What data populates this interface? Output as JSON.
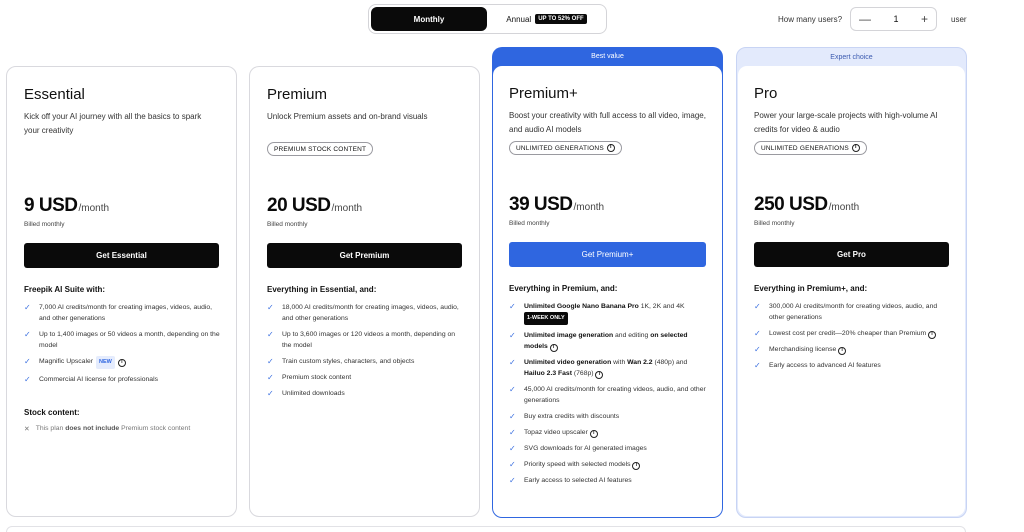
{
  "billing": {
    "monthly_label": "Monthly",
    "annual_label": "Annual",
    "annual_badge": "UP TO 52% OFF"
  },
  "users": {
    "label": "How many users?",
    "minus": "—",
    "value": "1",
    "plus": "+",
    "suffix": "user"
  },
  "plans": {
    "essential": {
      "name": "Essential",
      "desc": "Kick off your AI journey with all the basics to spark your creativity",
      "price": "9 USD",
      "per": "/month",
      "billed": "Billed monthly",
      "cta": "Get Essential",
      "features_head": "Freepik AI Suite with:",
      "f1": "7,000 AI credits/month for creating images, videos, audio, and other generations",
      "f2": "Up to 1,400 images or 50 videos a month, depending on the model",
      "f3": "Magnific Upscaler",
      "f3_tag": "NEW",
      "f4": "Commercial AI license for professionals",
      "stock_head": "Stock content:",
      "stock_a": "This plan",
      "stock_b": "does not include",
      "stock_c": "Premium stock content"
    },
    "premium": {
      "name": "Premium",
      "desc": "Unlock Premium assets and on-brand visuals",
      "pill": "PREMIUM STOCK CONTENT",
      "price": "20 USD",
      "per": "/month",
      "billed": "Billed monthly",
      "cta": "Get Premium",
      "features_head": "Everything in Essential, and:",
      "f1": "18,000 AI credits/month for creating images, videos, audio, and other generations",
      "f2": "Up to 3,600 images or 120 videos a month, depending on the model",
      "f3": "Train custom styles, characters, and objects",
      "f4": "Premium stock content",
      "f5": "Unlimited downloads"
    },
    "premium_plus": {
      "ribbon": "Best value",
      "name": "Premium+",
      "desc": "Boost your creativity with full access to all video, image, and audio AI models",
      "pill": "UNLIMITED GENERATIONS",
      "price": "39 USD",
      "per": "/month",
      "billed": "Billed monthly",
      "cta": "Get Premium+",
      "features_head": "Everything in Premium, and:",
      "f1_b": "Unlimited Google Nano Banana Pro",
      "f1_r": "1K, 2K and 4K",
      "f1_tag": "1-WEEK ONLY",
      "f2_b1": "Unlimited image generation",
      "f2_r": "and editing",
      "f2_b2": "on selected models",
      "f3_b1": "Unlimited video generation",
      "f3_r1": "with",
      "f3_b2": "Wan 2.2",
      "f3_r2": "(480p) and",
      "f3_b3": "Hailuo 2.3 Fast",
      "f3_r3": "(768p)",
      "f4": "45,000 AI credits/month for creating videos, audio, and other generations",
      "f5": "Buy extra credits with discounts",
      "f6": "Topaz video upscaler",
      "f7": "SVG downloads for AI generated images",
      "f8": "Priority speed with selected models",
      "f9": "Early access to selected AI features"
    },
    "pro": {
      "ribbon": "Expert choice",
      "name": "Pro",
      "desc": "Power your large-scale projects with high-volume AI credits for video & audio",
      "pill": "UNLIMITED GENERATIONS",
      "price": "250 USD",
      "per": "/month",
      "billed": "Billed monthly",
      "cta": "Get Pro",
      "features_head": "Everything in Premium+, and:",
      "f1": "300,000 AI credits/month for creating videos, audio, and other generations",
      "f2": "Lowest cost per credit—20% cheaper than Premium",
      "f3": "Merchandising license",
      "f4": "Early access to advanced AI features"
    }
  },
  "icons": {
    "check": "check-icon",
    "cross": "x-icon",
    "info": "info-icon"
  },
  "colors": {
    "accent_blue": "#2f66e0",
    "dark": "#0a0a0a",
    "expert_bg": "#e3eafc"
  }
}
